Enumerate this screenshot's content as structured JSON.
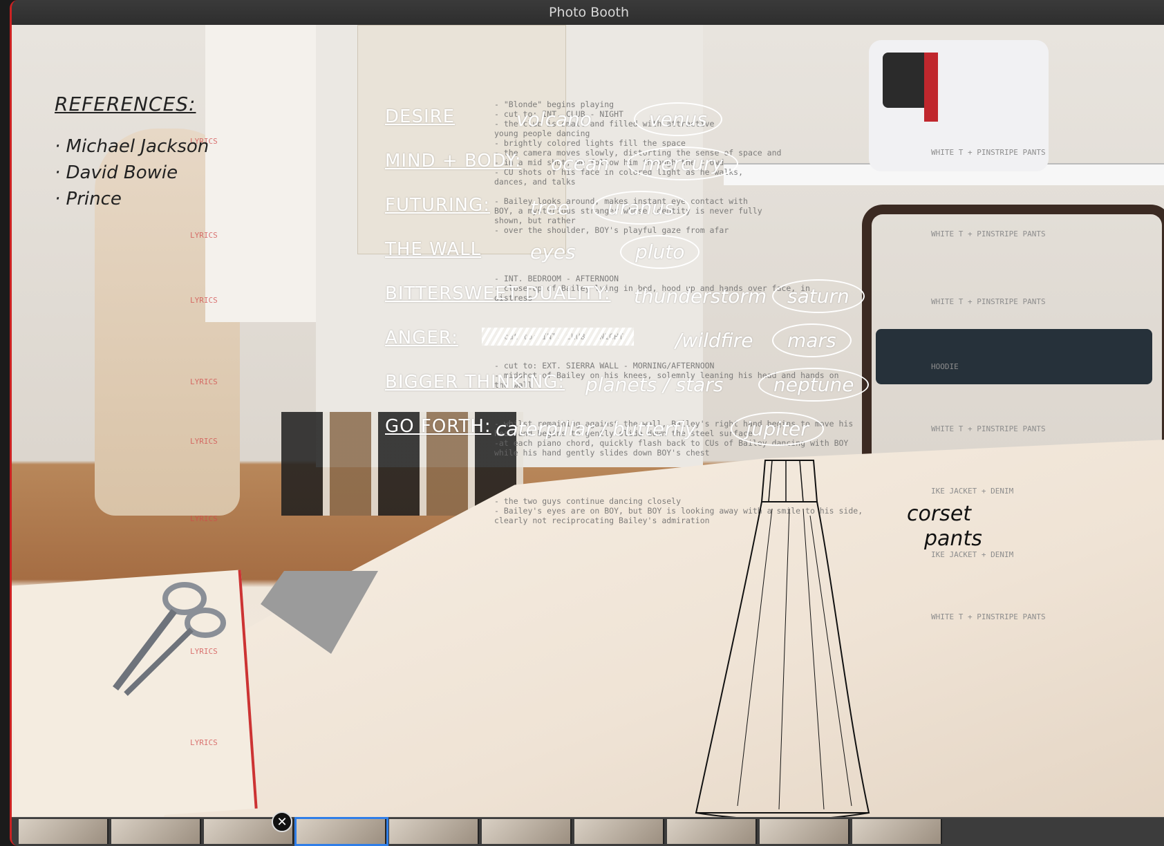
{
  "window": {
    "title": "Photo Booth"
  },
  "references": {
    "title": "REFERENCES:",
    "items": [
      "· Michael Jackson",
      "· David Bowie",
      "· Prince"
    ]
  },
  "overlay_rows": [
    {
      "category": "DESIRE",
      "element": "volcano",
      "planet": "venus"
    },
    {
      "category": "MIND + BODY:",
      "element": "ocean",
      "planet": "mercury"
    },
    {
      "category": "FUTURING:",
      "element": "tree",
      "planet": "uranus"
    },
    {
      "category": "THE WALL",
      "element": "eyes",
      "planet": "pluto"
    },
    {
      "category": "BITTERSWEET DUALITY:",
      "element": "thunderstorm",
      "planet": "saturn"
    },
    {
      "category": "ANGER:",
      "element": "/wildfire",
      "planet": "mars"
    },
    {
      "category": "BIGGER THINKING:",
      "element": "planets / stars",
      "planet": "neptune"
    },
    {
      "category": "GO FORTH:",
      "element": "caterpillar / butterfly",
      "planet": "jupiter"
    }
  ],
  "script_lines": [
    "- \"Blonde\" begins playing",
    "- cut to: INT. CLUB - NIGHT",
    "- the club is small and filled with attractive",
    "young people dancing",
    "- brightly colored lights fill the space",
    "- the camera moves slowly, distorting the sense of space and",
    "- in a mid shot, we follow him through the crowd",
    "- CU shots of his face in colored light as he walks,",
    "dances, and talks",
    "",
    "- Bailey looks around, makes instant eye contact with",
    "BOY, a mysterious stranger whose identity is never fully",
    "shown, but rather",
    "- over the shoulder, BOY's playful gaze from afar",
    "",
    "",
    "",
    "",
    "- INT. BEDROOM - AFTERNOON",
    "- close-up of Bailey lying in bed, hood up and hands over face, in",
    "distress",
    "",
    "",
    "",
    "- cut to: INT. CLUB - NIGHT",
    "",
    "",
    "- cut to: EXT. SIERRA WALL - MORNING/AFTERNOON",
    "- midshot of Bailey on his knees, solemnly leaning his head and hands on",
    "the wall",
    "",
    "",
    "",
    "- whilst remaining against the wall, Bailey's right hand begins to move his",
    "head and begins to gently slide down the steel surface",
    "-at each piano chord, quickly flash back to CUs of Bailey dancing with BOY",
    "while his hand gently slides down BOY's chest",
    "",
    "",
    "",
    "",
    "- the two guys continue dancing closely",
    "- Bailey's eyes are on BOY, but BOY is looking away with a smile to his side,",
    "clearly not reciprocating Bailey's admiration"
  ],
  "wardrobe_cues": [
    "WHITE T + PINSTRIPE PANTS",
    "WHITE T + PINSTRIPE PANTS",
    "WHITE T + PINSTRIPE PANTS",
    "HOODIE",
    "WHITE T + PINSTRIPE PANTS",
    "IKE JACKET + DENIM",
    "IKE JACKET + DENIM",
    "WHITE T + PINSTRIPE PANTS"
  ],
  "lyrics_markers": [
    "LYRICS",
    "LYRICS",
    "LYRICS",
    "LYRICS",
    "LYRICS",
    "LYRICS",
    "LYRICS",
    "LYRICS"
  ],
  "sketch_note": {
    "line1": "corset",
    "line2": "pants"
  },
  "filmstrip": {
    "close_glyph": "✕",
    "thumb_count": 10,
    "selected_index": 3
  }
}
